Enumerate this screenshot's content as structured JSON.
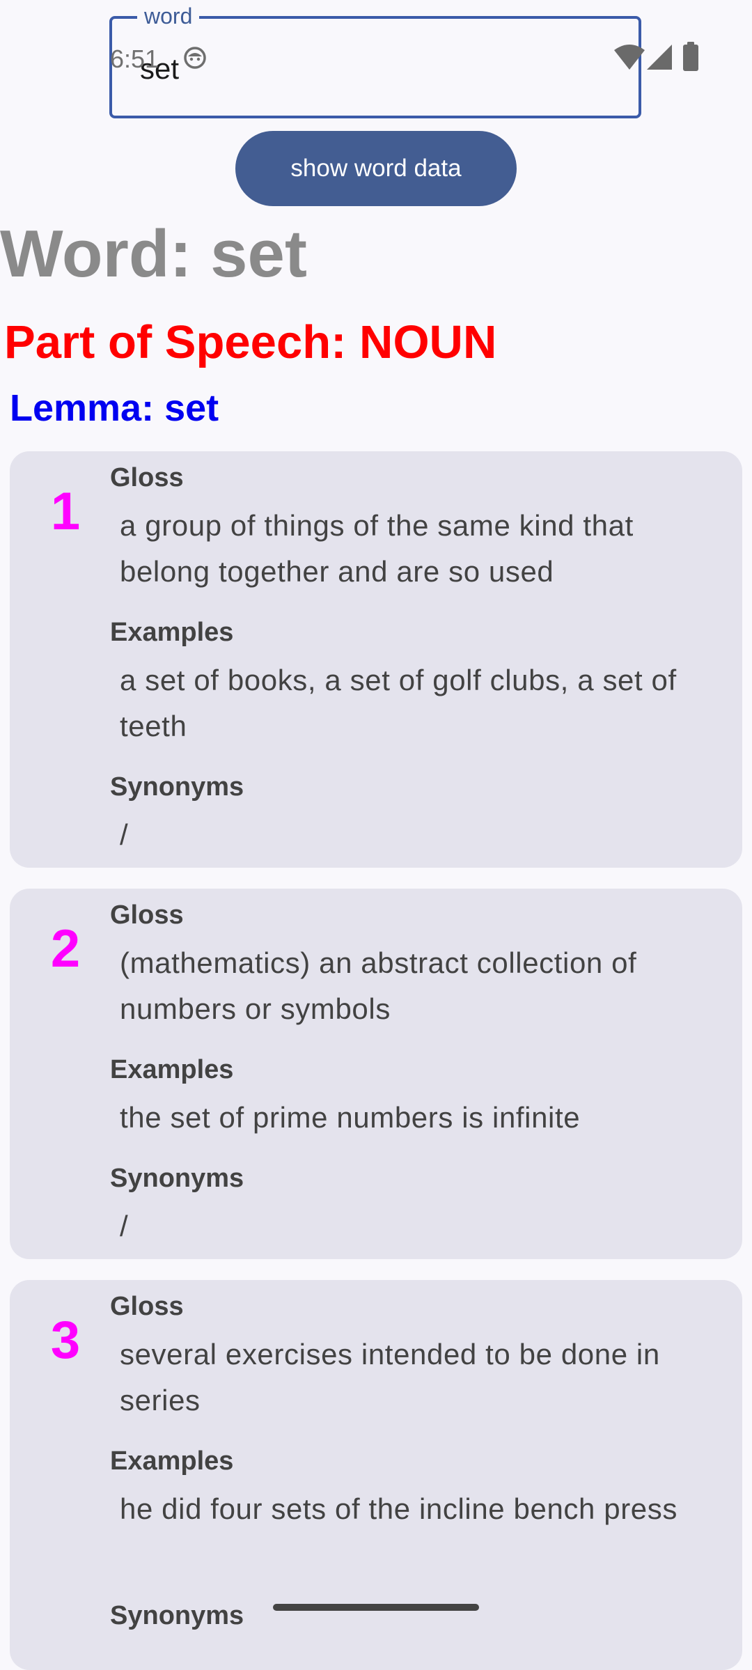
{
  "status_bar": {
    "time": "6:51",
    "icons": [
      "android-debug-icon",
      "wifi-icon",
      "cellular-signal-icon",
      "battery-icon"
    ]
  },
  "search": {
    "label": "word",
    "value": "set"
  },
  "show_button": {
    "label": "show word data"
  },
  "word_header": "Word: set",
  "pos_header": "Part of Speech: NOUN",
  "lemma_header": "Lemma: set",
  "section_labels": {
    "gloss": "Gloss",
    "examples": "Examples",
    "synonyms": "Synonyms"
  },
  "senses": [
    {
      "number": "1",
      "gloss": "a group of things of the same kind that belong together and are so used",
      "examples": "a set of books, a set of golf clubs, a set of teeth",
      "synonyms": "/"
    },
    {
      "number": "2",
      "gloss": "(mathematics) an abstract collection of numbers or symbols",
      "examples": "the set of prime numbers is infinite",
      "synonyms": "/"
    },
    {
      "number": "3",
      "gloss": "several exercises intended to be done in series",
      "examples": "he did four sets of the incline bench press",
      "synonyms": ""
    }
  ],
  "colors": {
    "accent": "#435d92",
    "word_header": "#8a8a8a",
    "pos_header": "#ff0000",
    "lemma_header": "#0000f0",
    "sense_number": "#ff00ff",
    "card_bg": "#e4e3ed",
    "page_bg": "#f9f8fc"
  }
}
